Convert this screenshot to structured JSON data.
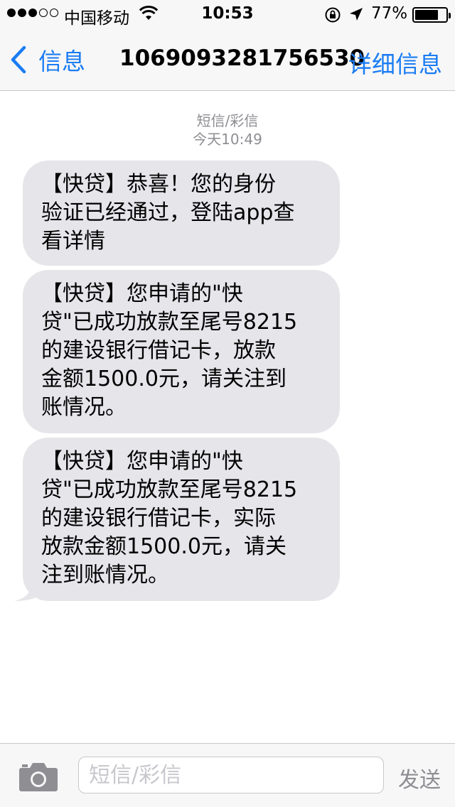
{
  "status_bar": {
    "carrier": "中国移动",
    "time": "10:53",
    "battery_percent": "77%",
    "battery_level": 0.77,
    "icons": [
      "signal-dots",
      "wifi-icon",
      "rotation-lock-icon",
      "location-arrow-icon",
      "battery-icon"
    ]
  },
  "nav": {
    "back_label": "信息",
    "title": "1069093281756530",
    "details_label": "详细信息"
  },
  "conversation": {
    "kind": "短信/彩信",
    "timestamp": "今天10:49",
    "messages": [
      {
        "text": "【快贷】恭喜！您的身份\n验证已经通过，登陆app查\n看详情"
      },
      {
        "text": "【快贷】您申请的\"快\n贷\"已成功放款至尾号8215\n的建设银行借记卡，放款\n金额1500.0元，请关注到\n账情况。"
      },
      {
        "text": "【快贷】您申请的\"快\n贷\"已成功放款至尾号8215\n的建设银行借记卡，实际\n放款金额1500.0元，请关\n注到账情况。"
      }
    ]
  },
  "input_bar": {
    "placeholder": "短信/彩信",
    "value": "",
    "send_label": "发送"
  },
  "colors": {
    "accent": "#1a7cf3",
    "bubble": "#e5e5ea",
    "meta_text": "#8e8e93"
  }
}
